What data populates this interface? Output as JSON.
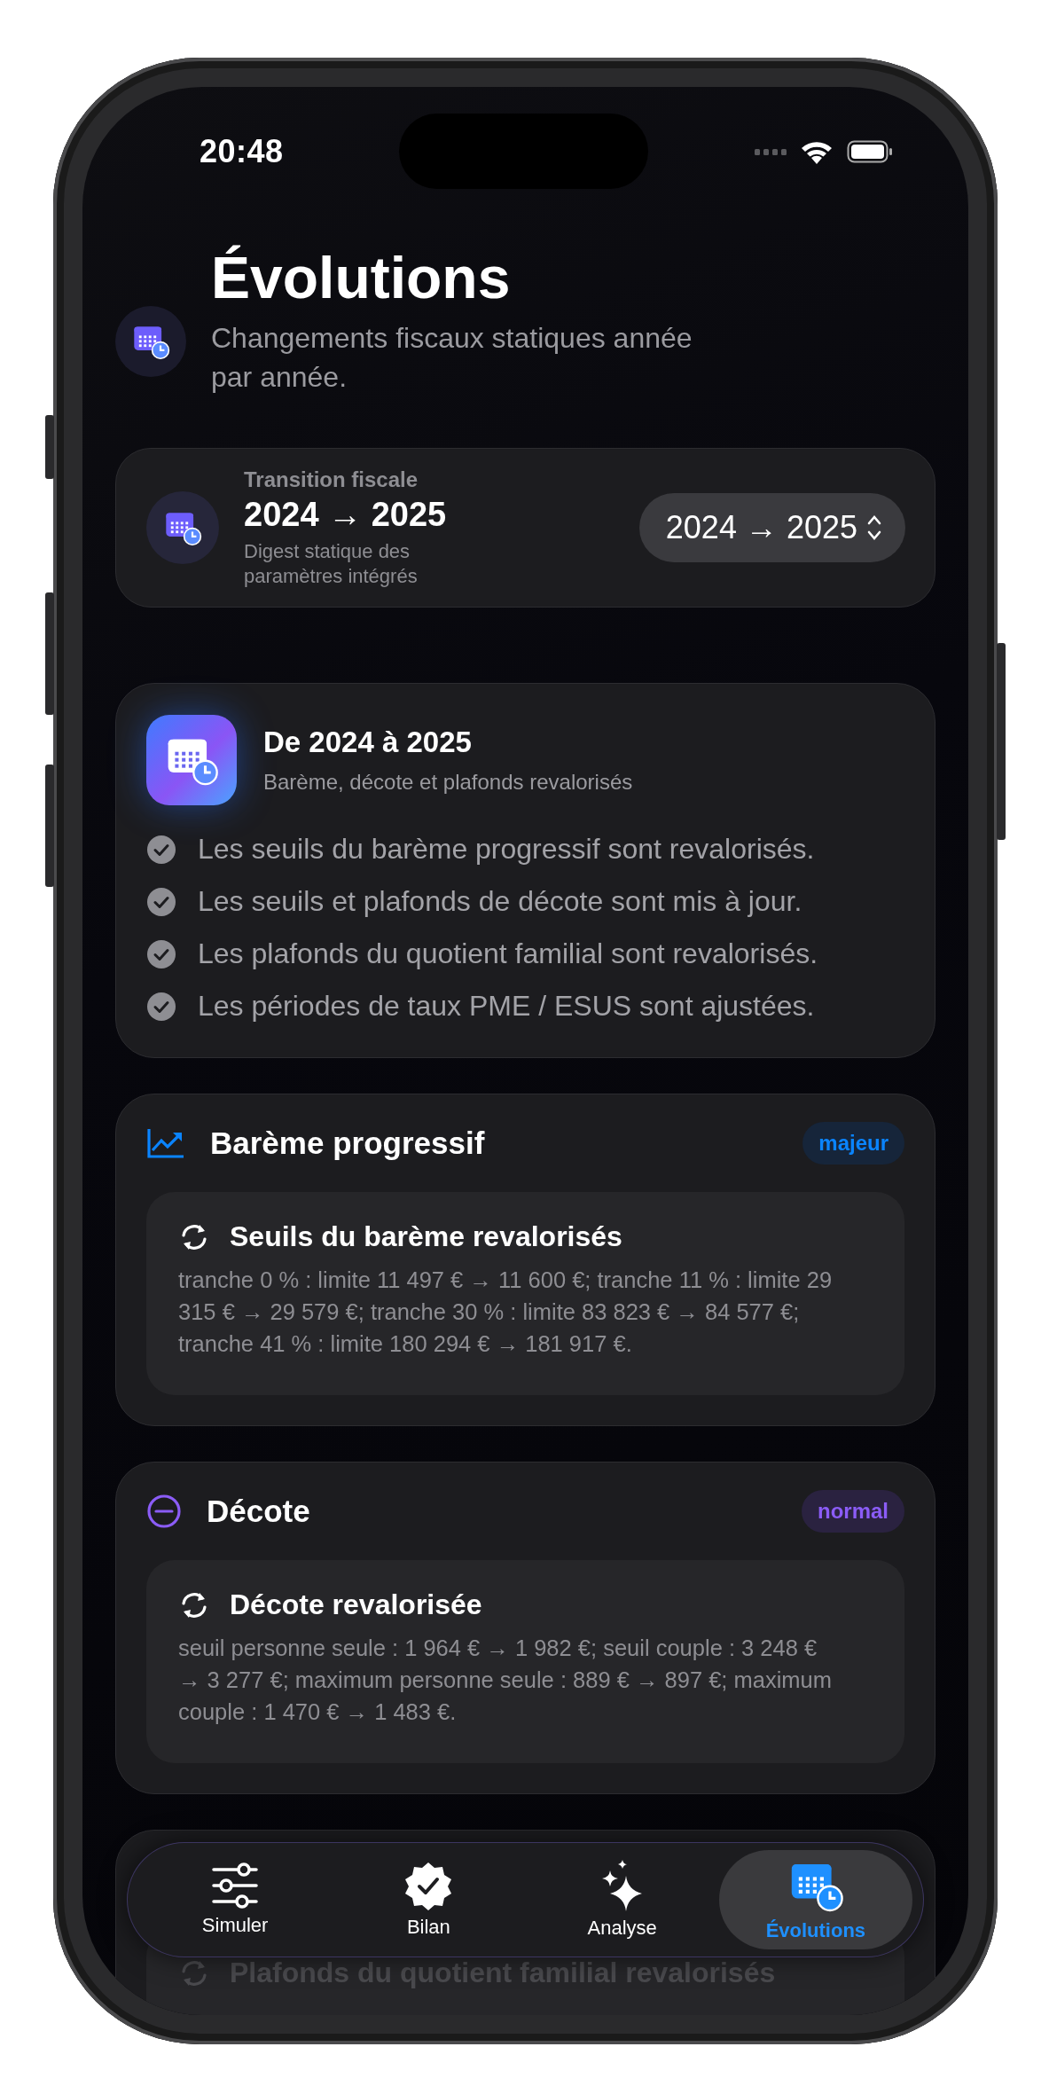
{
  "status_bar": {
    "time": "20:48"
  },
  "header": {
    "title": "Évolutions",
    "subtitle": "Changements fiscaux statiques année par année."
  },
  "transition": {
    "label": "Transition fiscale",
    "value": "2024 → 2025",
    "caption": "Digest statique des paramètres intégrés",
    "picker": {
      "value": "2024 → 2025"
    }
  },
  "summary": {
    "title": "De 2024 à 2025",
    "subtitle": "Barème, décote et plafonds revalorisés",
    "points": [
      {
        "text": "Les seuils du barème progressif sont revalorisés."
      },
      {
        "text": "Les seuils et plafonds de décote sont mis à jour."
      },
      {
        "text": "Les plafonds du quotient familial sont revalorisés."
      },
      {
        "text": "Les périodes de taux PME / ESUS sont ajustées."
      }
    ]
  },
  "sections": [
    {
      "kind": "chart",
      "title": "Barème progressif",
      "badge": {
        "label": "majeur",
        "kind": "major"
      },
      "items": [
        {
          "title": "Seuils du barème revalorisés",
          "detail": "tranche 0 % : limite 11 497 € → 11 600 €; tranche 11 % : limite 29 315 € → 29 579 €; tranche 30 % : limite 83 823 € → 84 577 €; tranche 41 % : limite 180 294 € → 181 917 €."
        }
      ]
    },
    {
      "kind": "minus",
      "title": "Décote",
      "badge": {
        "label": "normal",
        "kind": "normal"
      },
      "items": [
        {
          "title": "Décote revalorisée",
          "detail": "seuil personne seule : 1 964 € → 1 982 €; seuil couple : 3 248 € → 3 277 €; maximum personne seule : 889 € → 897 €; maximum couple : 1 470 € → 1 483 €."
        }
      ]
    },
    {
      "kind": "hidden",
      "items": [
        {
          "title": "Plafonds du quotient familial revalorisés"
        }
      ]
    }
  ],
  "tab_bar": [
    {
      "kind": "sliders",
      "label": "Simuler",
      "selected": false
    },
    {
      "kind": "seal",
      "label": "Bilan",
      "selected": false
    },
    {
      "kind": "sparkles",
      "label": "Analyse",
      "selected": false
    },
    {
      "kind": "calendar",
      "label": "Évolutions",
      "selected": true
    }
  ]
}
